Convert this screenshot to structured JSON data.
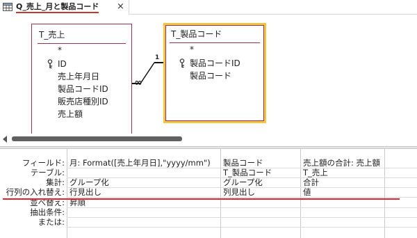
{
  "tab": {
    "title": "Q_売上_月と製品コード",
    "close": "×",
    "icon": "query-icon"
  },
  "tables": {
    "sales": {
      "name": "T_売上",
      "star": "*",
      "fields": [
        "ID",
        "売上年月日",
        "製品コードID",
        "販売店種別ID",
        "売上額"
      ],
      "key_field_index": 0
    },
    "product": {
      "name": "T_製品コード",
      "star": "*",
      "fields": [
        "製品コードID",
        "製品コード"
      ],
      "key_field_index": 0
    }
  },
  "relationship": {
    "one_label": "1",
    "many_label": "∞"
  },
  "grid": {
    "row_labels": [
      "フィールド:",
      "テーブル:",
      "集計:",
      "行列の入れ替え:",
      "並べ替え:",
      "抽出条件:",
      "または:"
    ],
    "columns": [
      {
        "field": "月: Format([売上年月日],\"yyyy/mm\")",
        "table": "",
        "total": "グループ化",
        "crosstab": "行見出し",
        "sort": "昇順",
        "criteria": "",
        "or": ""
      },
      {
        "field": "製品コード",
        "table": "T_製品コード",
        "total": "グループ化",
        "crosstab": "列見出し",
        "sort": "",
        "criteria": "",
        "or": ""
      },
      {
        "field": "売上額の合計: 売上額",
        "table": "T_売上",
        "total": "合計",
        "crosstab": "値",
        "sort": "",
        "criteria": "",
        "or": ""
      }
    ]
  },
  "colors": {
    "table_border": "#a0314a",
    "selected_table_border": "#f6c342",
    "highlight_line": "#e8202a"
  }
}
